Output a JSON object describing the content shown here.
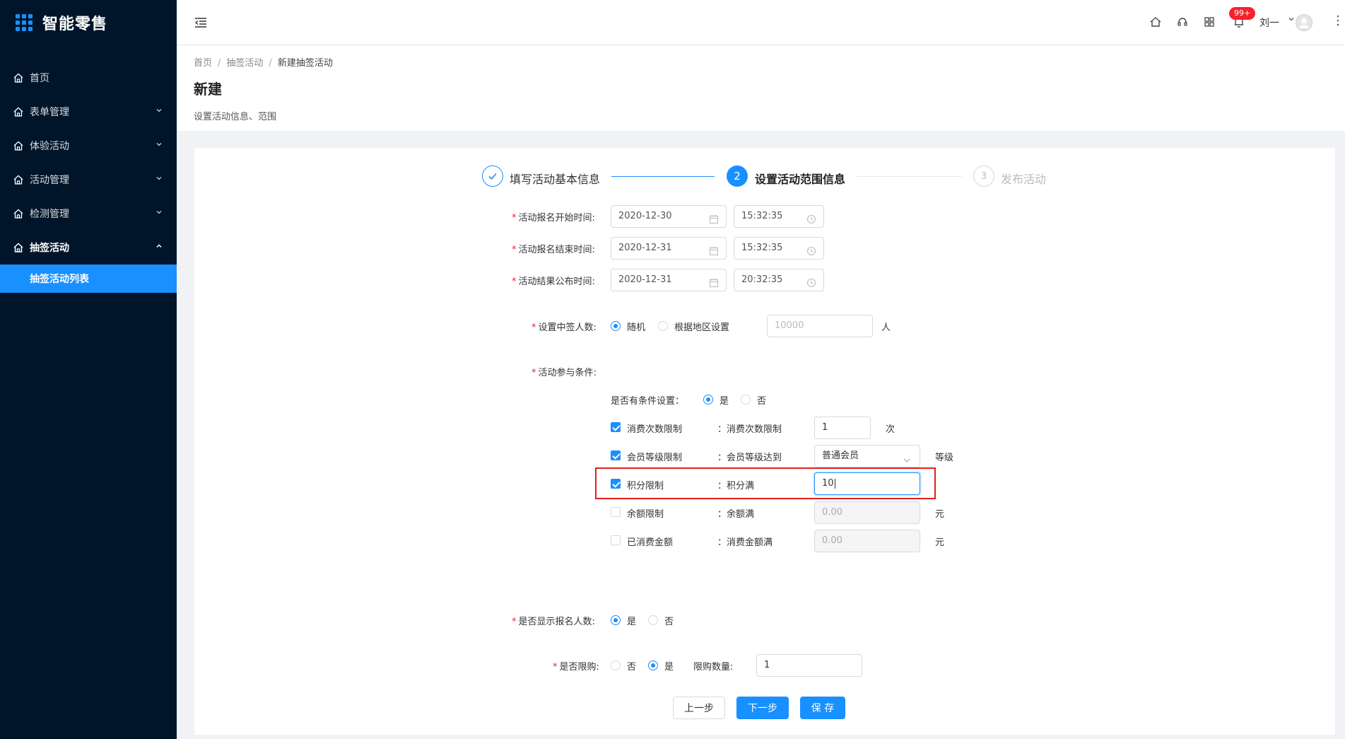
{
  "app": {
    "title": "智能零售",
    "accent": "#1890ff",
    "sidebar_bg": "#001529"
  },
  "sidebar": {
    "items": [
      {
        "label": "首页"
      },
      {
        "label": "表单管理"
      },
      {
        "label": "体验活动"
      },
      {
        "label": "活动管理"
      },
      {
        "label": "检测管理"
      },
      {
        "label": "抽签活动"
      }
    ],
    "active_sub": "抽签活动列表"
  },
  "header": {
    "badge": "99+",
    "user": "刘一",
    "icons": [
      "home-icon",
      "headset-icon",
      "grid-icon",
      "bell-icon",
      "avatar",
      "more-icon"
    ]
  },
  "page": {
    "breadcrumb": [
      "首页",
      "抽签活动",
      "新建抽签活动"
    ],
    "title": "新建",
    "description": "设置活动信息、范围"
  },
  "steps": [
    {
      "num": "",
      "label": "填写活动基本信息",
      "status": "done"
    },
    {
      "num": "2",
      "label": "设置活动范围信息",
      "status": "active"
    },
    {
      "num": "3",
      "label": "发布活动",
      "status": "wait"
    }
  ],
  "form": {
    "signup_start": {
      "label": "活动报名开始时间:",
      "date": "2020-12-30",
      "time": "15:32:35"
    },
    "signup_end": {
      "label": "活动报名结束时间:",
      "date": "2020-12-31",
      "time": "15:32:35"
    },
    "result_time": {
      "label": "活动结果公布时间:",
      "date": "2020-12-31",
      "time": "20:32:35"
    },
    "winners": {
      "label": "设置中签人数:",
      "opt_random": "随机",
      "opt_region": "根据地区设置",
      "placeholder": "10000",
      "unit": "人"
    },
    "conditions": {
      "label": "活动参与条件:",
      "has_label": "是否有条件设置：",
      "yes": "是",
      "no": "否",
      "rows": [
        {
          "check": "消费次数限制",
          "desc": "：消费次数限制",
          "value": "1",
          "unit": "次"
        },
        {
          "check": "会员等级限制",
          "desc": "：会员等级达到",
          "value": "普通会员",
          "unit": "等级"
        },
        {
          "check": "积分限制",
          "desc": "：积分满",
          "value": "10",
          "unit": ""
        },
        {
          "check": "余额限制",
          "desc": "：余额满",
          "placeholder": "0.00",
          "unit": "元"
        },
        {
          "check": "已消费金额",
          "desc": "：消费金额满",
          "placeholder": "0.00",
          "unit": "元"
        }
      ]
    },
    "show_count": {
      "label": "是否显示报名人数:",
      "yes": "是",
      "no": "否"
    },
    "limit_buy": {
      "label": "是否限购:",
      "no": "否",
      "yes": "是",
      "qty_label": "限购数量:",
      "qty": "1"
    }
  },
  "buttons": {
    "prev": "上一步",
    "next": "下一步",
    "save": "保 存"
  }
}
